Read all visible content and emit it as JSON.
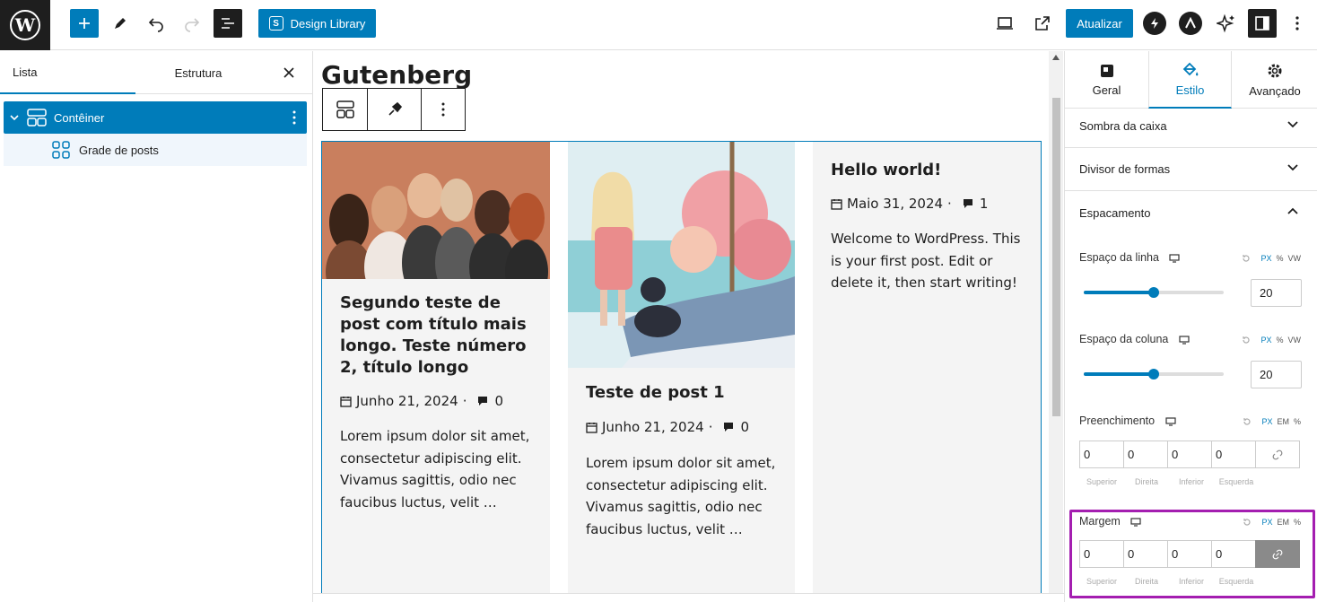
{
  "toolbar": {
    "design_library_label": "Design Library",
    "design_library_icon": "S",
    "update_label": "Atualizar"
  },
  "left_panel": {
    "tab_list": "Lista",
    "tab_structure": "Estrutura",
    "tree": [
      {
        "label": "Contêiner"
      },
      {
        "label": "Grade de posts"
      }
    ]
  },
  "canvas": {
    "page_title": "Gutenberg",
    "posts": [
      {
        "title": "Segundo teste de post com título mais longo. Teste número 2, título longo",
        "date": "Junho 21, 2024",
        "comments": "0",
        "excerpt": "Lorem ipsum dolor sit amet, consectetur adipiscing elit. Vivamus sagittis, odio nec faucibus luctus, velit …"
      },
      {
        "title": "Teste de post 1",
        "date": "Junho 21, 2024",
        "comments": "0",
        "excerpt": "Lorem ipsum dolor sit amet, consectetur adipiscing elit. Vivamus sagittis, odio nec faucibus luctus, velit …"
      },
      {
        "title": "Hello world!",
        "date": "Maio 31, 2024",
        "comments": "1",
        "excerpt": "Welcome to WordPress. This is your first post. Edit or delete it, then start writing!"
      }
    ]
  },
  "right_panel": {
    "tabs": [
      "Geral",
      "Estilo",
      "Avançado"
    ],
    "sections": {
      "box_shadow": "Sombra da caixa",
      "shape_divider": "Divisor de formas",
      "spacing": "Espacamento"
    },
    "row_gap": {
      "label": "Espaço da linha",
      "value": "20",
      "level": 0.5,
      "units": [
        "PX",
        "%",
        "VW"
      ]
    },
    "column_gap": {
      "label": "Espaço da coluna",
      "value": "20",
      "level": 0.5,
      "units": [
        "PX",
        "%",
        "VW"
      ]
    },
    "padding": {
      "label": "Preenchimento",
      "units": [
        "PX",
        "EM",
        "%"
      ],
      "values": [
        "0",
        "0",
        "0",
        "0"
      ]
    },
    "margin": {
      "label": "Margem",
      "units": [
        "PX",
        "EM",
        "%"
      ],
      "values": [
        "0",
        "0",
        "0",
        "0"
      ]
    },
    "sides": [
      "Superior",
      "Direita",
      "Inferior",
      "Esquerda"
    ]
  },
  "colors": {
    "accent": "#007cba",
    "highlight": "#a41eb0",
    "dark": "#1e1e1e"
  }
}
